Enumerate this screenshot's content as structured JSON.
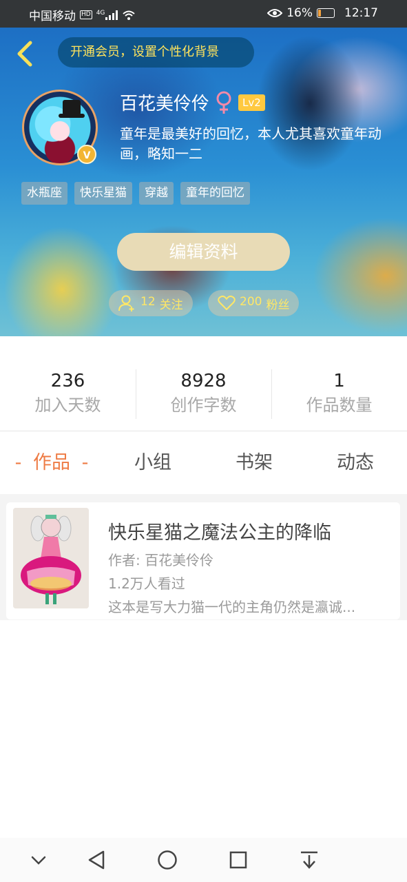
{
  "status_bar": {
    "carrier": "中国移动",
    "network_badge": "HD",
    "network_type": "4G",
    "battery_percent": "16%",
    "battery_level": 0.16,
    "time": "12:17",
    "icons": [
      "hd-icon",
      "signal-icon",
      "wifi-icon",
      "eye-icon",
      "battery-icon"
    ]
  },
  "header": {
    "vip_prompt": "开通会员，设置个性化背景",
    "nickname": "百花美伶伶",
    "gender_symbol": "♀",
    "level": "Lv2",
    "verified_badge": "V",
    "bio": "童年是最美好的回忆，本人尤其喜欢童年动画，略知一二",
    "tags": [
      "水瓶座",
      "快乐星猫",
      "穿越",
      "童年的回忆"
    ],
    "edit_button": "编辑资料",
    "following": {
      "count": "12",
      "label": "关注"
    },
    "followers": {
      "count": "200",
      "label": "粉丝"
    },
    "colors": {
      "vip_text": "#ffe35c",
      "level_bg": "#ffc940",
      "edit_bg": "#e8dbb6",
      "gender": "#f48aa8"
    }
  },
  "stats": [
    {
      "value": "236",
      "label": "加入天数"
    },
    {
      "value": "8928",
      "label": "创作字数"
    },
    {
      "value": "1",
      "label": "作品数量"
    }
  ],
  "tabs": {
    "active_decor": "-",
    "items": [
      {
        "label": "作品",
        "active": true
      },
      {
        "label": "小组",
        "active": false
      },
      {
        "label": "书架",
        "active": false
      },
      {
        "label": "动态",
        "active": false
      }
    ],
    "active_color": "#ee7b44"
  },
  "works": [
    {
      "title": "快乐星猫之魔法公主的降临",
      "author": "作者: 百花美伶伶",
      "views": "1.2万人看过",
      "description": "这本是写大力猫一代的主角仍然是瀛诚..."
    }
  ],
  "nav_bar": [
    "chevron-down-icon",
    "back-triangle-icon",
    "home-circle-icon",
    "recents-square-icon",
    "download-icon"
  ]
}
